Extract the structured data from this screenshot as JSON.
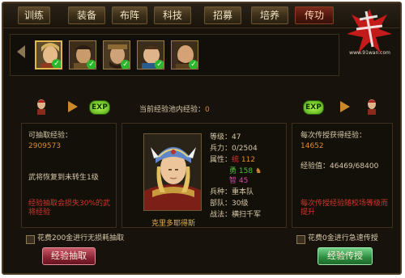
{
  "tabs": [
    {
      "label": "训练"
    },
    {
      "label": "装备"
    },
    {
      "label": "布阵"
    },
    {
      "label": "科技"
    },
    {
      "label": "招募"
    },
    {
      "label": "培养"
    },
    {
      "label": "传功"
    }
  ],
  "logo": {
    "site": "www.91wan.com"
  },
  "pool": {
    "label": "当前经验池内经验：",
    "value": "0"
  },
  "left": {
    "extract_label": "可抽取经验：",
    "extract_value": "2909573",
    "reset_text": "武将恢复到未转生1级",
    "warning_text": "经验抽取会损失30%的武将经验"
  },
  "hero": {
    "name": "克里多耶得斯",
    "level_label": "等级：",
    "level": "47",
    "troops_label": "兵力：",
    "troops": "0/2504",
    "attr_label": "属性：",
    "attr_tong_label": "统",
    "attr_tong": "112",
    "attr_yong_label": "勇",
    "attr_yong": "158",
    "attr_zhi_label": "智",
    "attr_zhi": "45",
    "unit_label": "兵种：",
    "unit": "重本队",
    "ranks_label": "部队：",
    "ranks": "30级",
    "skill_label": "战法：",
    "skill": "横扫千军"
  },
  "right": {
    "per_label": "每次传授获得经验：",
    "per_value": "14652",
    "exp_label": "经验值：",
    "exp_value": "46469/68400",
    "note_text": "每次传授经验随校场等级而提升"
  },
  "bottom": {
    "left_option": "花费200金进行无损耗抽取",
    "right_option": "花费0金进行急速传授",
    "extract_button": "经验抽取",
    "teach_button": "经验传授"
  },
  "exp_badge": "EXP",
  "colors": {
    "accent": "#d98d2e",
    "danger": "#d2372c",
    "success": "#4fbf38"
  }
}
